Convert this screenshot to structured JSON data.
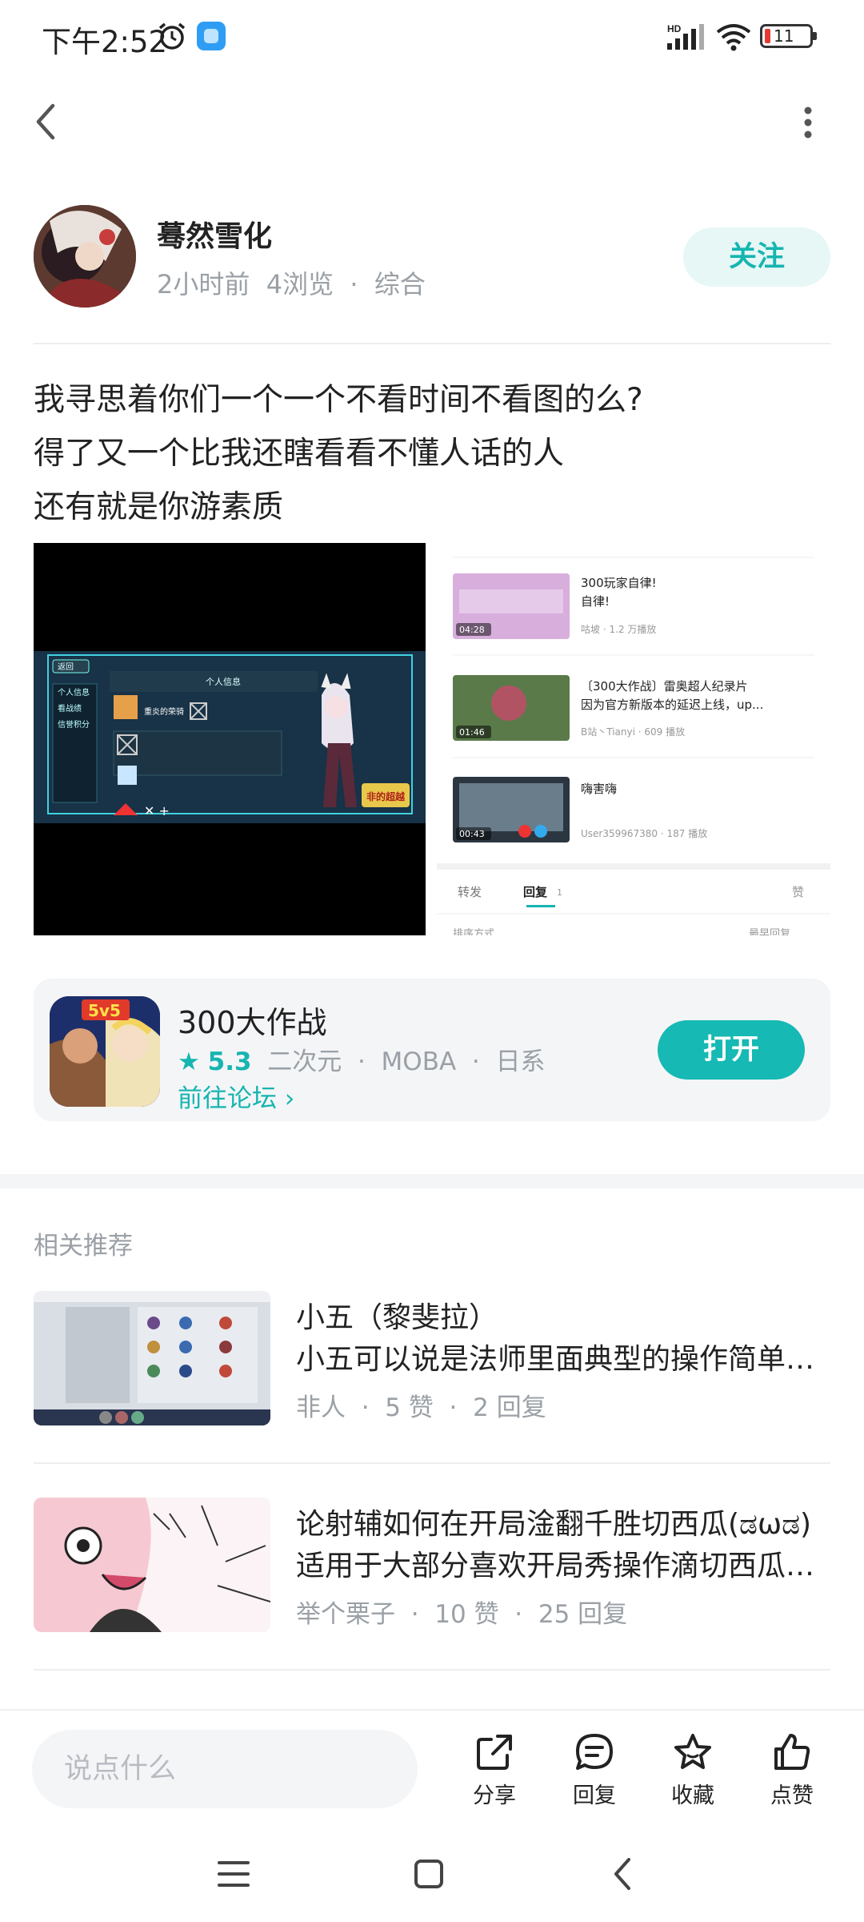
{
  "status_bar": {
    "time": "下午2:52",
    "battery": "11",
    "network": "HD"
  },
  "author": {
    "name": "蓦然雪化",
    "meta": "2小时前  4浏览  ·  综合",
    "follow_label": "关注"
  },
  "post": {
    "lines": [
      "我寻思着你们一个一个不看时间不看图的么?",
      "得了又一个比我还瞎看看不懂人话的人",
      "还有就是你游素质"
    ]
  },
  "screenshot_left": {
    "back": "返回",
    "panel_title": "个人信息",
    "menu": [
      "个人信息",
      "看战绩",
      "信誉积分"
    ],
    "player_name": "重炎的荣骑",
    "logo": "非的超越"
  },
  "screenshot_right": {
    "videos": [
      {
        "title": "300玩家自律!",
        "title2": "自律!",
        "meta": "咕坡 · 1.2 万播放",
        "duration": "04:28"
      },
      {
        "title": "〔300大作战〕雷奥超人纪录片",
        "title2": "因为官方新版本的延迟上线，up...",
        "meta": "B站丶Tianyi · 609 播放",
        "duration": "01:46"
      },
      {
        "title": "嗨害嗨",
        "title2": "",
        "meta": "User359967380 · 187 播放",
        "duration": "00:43"
      }
    ],
    "tabs": [
      "转发",
      "回复",
      "赞"
    ],
    "reply_count": "1",
    "sort_left": "排序方式",
    "sort_right": "最早回复"
  },
  "game": {
    "name": "300大作战",
    "score": "5.3",
    "tags": "  二次元  ·  MOBA  ·  日系",
    "forum_link": "前往论坛",
    "open_label": "打开",
    "icon_badge": "5v5"
  },
  "recommend": {
    "title": "相关推荐",
    "items": [
      {
        "name": "小五（黎斐拉）",
        "desc": "小五可以说是法师里面典型的操作简单但是上限很高的英雄",
        "meta": "非人  ·  5 赞  ·  2 回复"
      },
      {
        "name": "论射辅如何在开局淦翻千胜切西瓜(ಡωಡ)",
        "desc": "适用于大部分喜欢开局秀操作滴切西瓜的小伙伴们",
        "meta": "举个栗子  ·  10 赞  ·  25 回复"
      }
    ]
  },
  "bottom_bar": {
    "input_placeholder": "说点什么",
    "share": "分享",
    "reply": "回复",
    "favorite": "收藏",
    "like": "点赞"
  },
  "colors": {
    "accent": "#16b5b0",
    "accent_light": "#e6f7f6",
    "muted": "#9aa0a6"
  }
}
